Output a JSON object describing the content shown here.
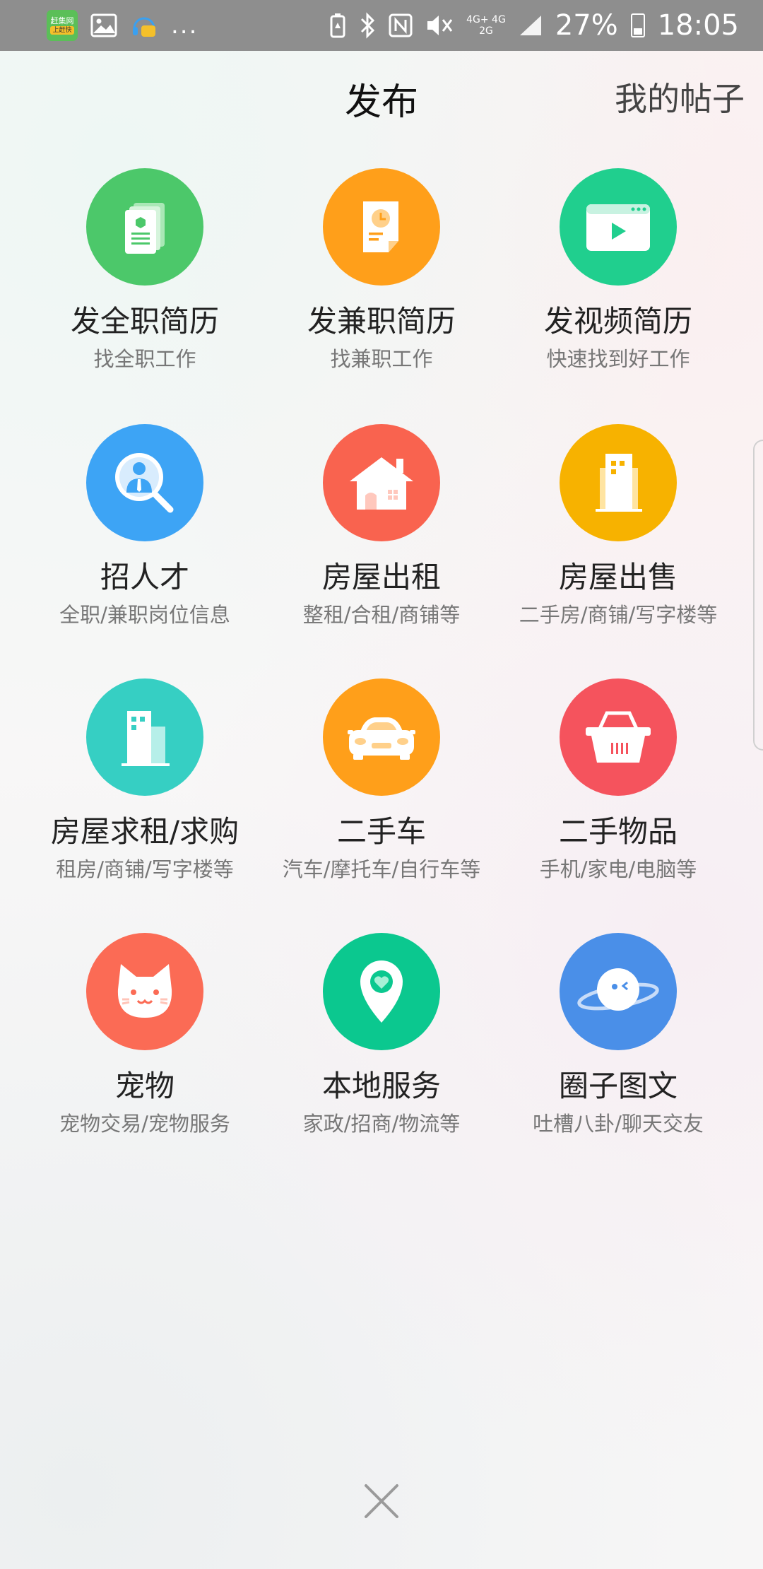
{
  "status_bar": {
    "app_badge_top": "赶集网",
    "app_badge_bottom": "上赶快",
    "more_indicator": "...",
    "network_top": "4G+ 4G",
    "network_bottom": "2G",
    "battery": "27%",
    "time": "18:05",
    "icons": [
      "image-icon",
      "headset-icon",
      "battery-saver-icon",
      "bluetooth-icon",
      "nfc-icon",
      "mute-icon",
      "signal-icon"
    ]
  },
  "header": {
    "title": "发布",
    "my_posts": "我的帖子"
  },
  "items": [
    {
      "title": "发全职简历",
      "sub": "找全职工作",
      "color": "#4cc86a",
      "icon": "resume-icon"
    },
    {
      "title": "发兼职简历",
      "sub": "找兼职工作",
      "color": "#ff9f1a",
      "icon": "part-time-resume-icon"
    },
    {
      "title": "发视频简历",
      "sub": "快速找到好工作",
      "color": "#20cf8e",
      "icon": "video-resume-icon"
    },
    {
      "title": "招人才",
      "sub": "全职/兼职岗位信息",
      "color": "#3da4f5",
      "icon": "talent-search-icon"
    },
    {
      "title": "房屋出租",
      "sub": "整租/合租/商铺等",
      "color": "#f9634f",
      "icon": "house-rent-icon"
    },
    {
      "title": "房屋出售",
      "sub": "二手房/商铺/写字楼等",
      "color": "#f7b200",
      "icon": "building-sale-icon"
    },
    {
      "title": "房屋求租/求购",
      "sub": "租房/商铺/写字楼等",
      "color": "#36cfc3",
      "icon": "building-wanted-icon"
    },
    {
      "title": "二手车",
      "sub": "汽车/摩托车/自行车等",
      "color": "#ff9f1a",
      "icon": "car-icon"
    },
    {
      "title": "二手物品",
      "sub": "手机/家电/电脑等",
      "color": "#f5535d",
      "icon": "basket-icon"
    },
    {
      "title": "宠物",
      "sub": "宠物交易/宠物服务",
      "color": "#fb6b55",
      "icon": "cat-icon"
    },
    {
      "title": "本地服务",
      "sub": "家政/招商/物流等",
      "color": "#0bc88f",
      "icon": "location-heart-icon"
    },
    {
      "title": "圈子图文",
      "sub": "吐槽八卦/聊天交友",
      "color": "#4a8fe8",
      "icon": "planet-icon"
    }
  ]
}
